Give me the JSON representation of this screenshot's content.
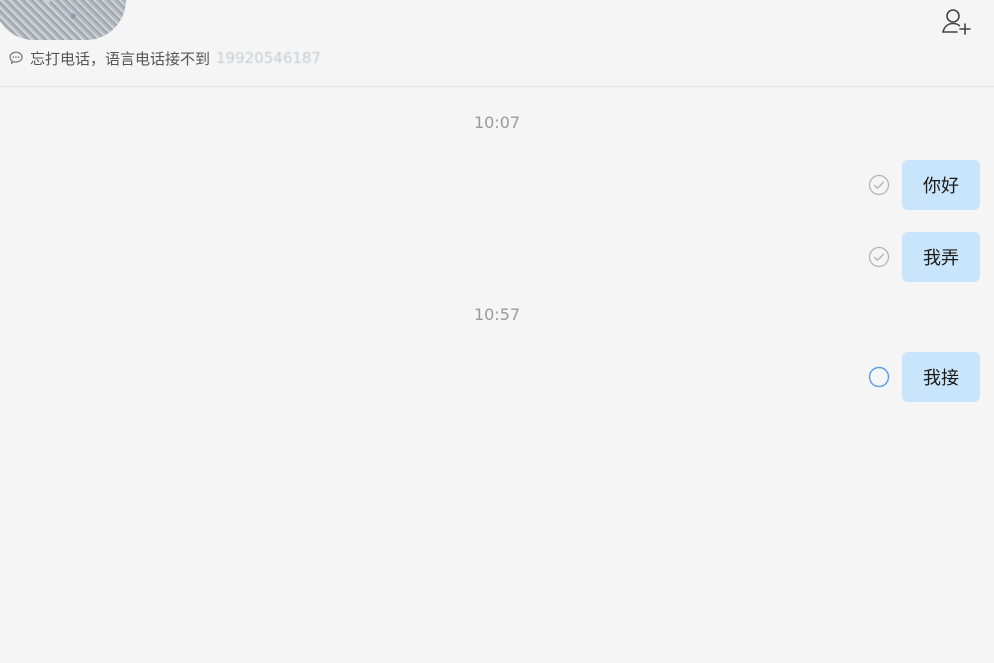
{
  "header": {
    "signature_text": "忘打电话，语言电话接不到",
    "signature_phone": "19920546187",
    "icons": {
      "signature": "chat-bubble-icon",
      "add_friend": "add-friend-icon"
    }
  },
  "conversation": {
    "timestamps": [
      "10:07",
      "10:57"
    ],
    "messages": [
      {
        "text": "你好",
        "status": "read"
      },
      {
        "text": "我弄",
        "status": "read"
      },
      {
        "text": "我接",
        "status": "sending"
      }
    ]
  },
  "colors": {
    "bubble_outgoing": "#c9e5fb",
    "status_read": "#b5b5b5",
    "status_sending": "#5a9ee6"
  }
}
